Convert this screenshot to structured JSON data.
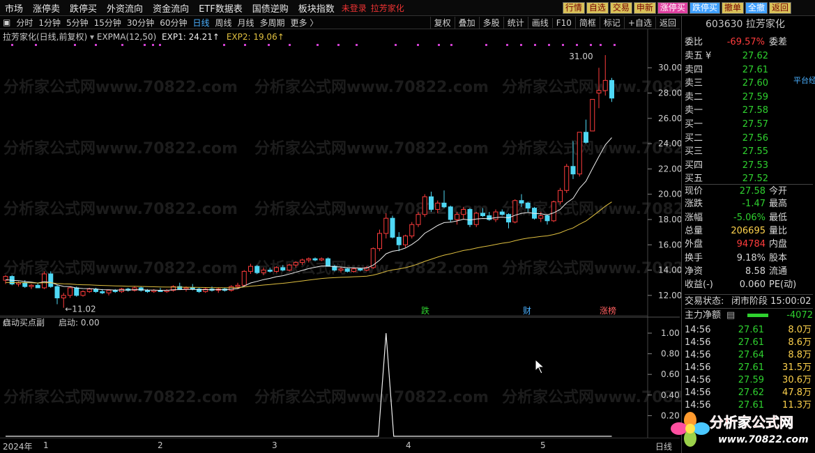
{
  "topnav": {
    "items": [
      "市场",
      "涨停卖",
      "跌停买",
      "外资流向",
      "资金流向",
      "ETF数据表",
      "国债逆购",
      "板块指数"
    ],
    "login": "未登录",
    "stock": "拉芳家化",
    "buttons": [
      "行情",
      "自选",
      "交易",
      "申新",
      "涨停买",
      "跌停买",
      "撤单",
      "全撤",
      "返回"
    ]
  },
  "subbar": {
    "periods": [
      "分时",
      "1分钟",
      "5分钟",
      "15分钟",
      "30分钟",
      "60分钟",
      "日线",
      "周线",
      "月线",
      "多周期",
      "更多 〉"
    ],
    "active": "日线",
    "tools": [
      "复权",
      "叠加",
      "多股",
      "统计",
      "画线",
      "F10",
      "简框",
      "标记",
      "+自选",
      "返回"
    ]
  },
  "chart": {
    "title": "拉芳家化(日线,前复权)",
    "indicator": "EXPMA(12,50)",
    "exp1": "EXP1: 24.21↑",
    "exp2": "EXP2: 19.06↑",
    "high_label": "31.00",
    "low_label": "←11.02",
    "yticks": [
      "30.00",
      "28.00",
      "26.00",
      "24.00",
      "22.00",
      "20.00",
      "18.00",
      "16.00",
      "14.00",
      "12.00"
    ],
    "events": [
      "跌",
      "财",
      "涨榜"
    ],
    "sub_title": "启动买点副",
    "sub_value": "启动: 0.00",
    "sub_yticks": [
      "1.00",
      "0.80",
      "0.60",
      "0.40",
      "0.20"
    ],
    "date_year": "2024年",
    "date_labels": [
      "1",
      "2",
      "3",
      "4",
      "5"
    ],
    "period_tab": "日线",
    "watermark": "分析家公式网www.70822.com"
  },
  "quote": {
    "code_name": "603630 拉芳家化",
    "weibi_label": "委比",
    "weibi": "-69.57%",
    "weicha_label": "委差",
    "asks": [
      {
        "l": "卖五",
        "p": "27.62"
      },
      {
        "l": "卖四",
        "p": "27.61"
      },
      {
        "l": "卖三",
        "p": "27.60"
      },
      {
        "l": "卖二",
        "p": "27.59"
      },
      {
        "l": "卖一",
        "p": "27.58"
      }
    ],
    "bids": [
      {
        "l": "买一",
        "p": "27.57"
      },
      {
        "l": "买二",
        "p": "27.56"
      },
      {
        "l": "买三",
        "p": "27.55"
      },
      {
        "l": "买四",
        "p": "27.53"
      },
      {
        "l": "买五",
        "p": "27.52"
      }
    ],
    "yen": "¥",
    "platform": "平台经",
    "stats": [
      {
        "l": "现价",
        "v": "27.58",
        "c": "g",
        "l2": "今开"
      },
      {
        "l": "涨跌",
        "v": "-1.47",
        "c": "g",
        "l2": "最高"
      },
      {
        "l": "涨幅",
        "v": "-5.06%",
        "c": "g",
        "l2": "最低"
      },
      {
        "l": "总量",
        "v": "206695",
        "c": "y",
        "l2": "量比"
      },
      {
        "l": "外盘",
        "v": "94784",
        "c": "r",
        "l2": "内盘"
      },
      {
        "l": "换手",
        "v": "9.18%",
        "c": "w",
        "l2": "股本"
      },
      {
        "l": "净资",
        "v": "8.58",
        "c": "w",
        "l2": "流通"
      },
      {
        "l": "收益(-)",
        "v": "0.060",
        "c": "w",
        "l2": "PE(动)"
      }
    ],
    "status_label": "交易状态:",
    "status": "闭市阶段 15:00:02",
    "flow_label": "主力净额",
    "flow": "-4072",
    "ticks": [
      [
        "14:56",
        "27.61",
        "8.0万"
      ],
      [
        "14:56",
        "27.61",
        "8.6万"
      ],
      [
        "14:56",
        "27.64",
        "8.8万"
      ],
      [
        "14:56",
        "27.61",
        "31.5万"
      ],
      [
        "14:56",
        "27.59",
        "30.6万"
      ],
      [
        "14:56",
        "27.62",
        "47.8万"
      ],
      [
        "14:56",
        "27.61",
        "11.3万"
      ]
    ]
  },
  "logo": {
    "name": "分析家公式网",
    "url": "www.70822.com"
  },
  "chart_data": {
    "type": "candlestick",
    "ylim": [
      11,
      31.5
    ],
    "candles": [
      [
        13.2,
        13.6,
        12.9,
        13.5
      ],
      [
        13.5,
        13.6,
        12.8,
        12.9
      ],
      [
        12.9,
        13.1,
        12.7,
        13.0
      ],
      [
        13.0,
        13.2,
        12.6,
        12.7
      ],
      [
        12.7,
        12.9,
        12.5,
        12.8
      ],
      [
        12.8,
        13.0,
        12.6,
        12.6
      ],
      [
        12.6,
        13.9,
        12.5,
        13.7
      ],
      [
        13.7,
        13.9,
        12.6,
        12.7
      ],
      [
        12.7,
        12.8,
        11.3,
        11.8
      ],
      [
        11.8,
        12.2,
        11.02,
        12.0
      ],
      [
        12.0,
        12.7,
        11.8,
        12.6
      ],
      [
        12.6,
        12.7,
        11.9,
        12.0
      ],
      [
        12.0,
        12.4,
        11.9,
        12.3
      ],
      [
        12.3,
        12.6,
        12.2,
        12.5
      ],
      [
        12.5,
        12.6,
        12.2,
        12.3
      ],
      [
        12.3,
        12.5,
        12.1,
        12.2
      ],
      [
        12.2,
        12.4,
        12.0,
        12.4
      ],
      [
        12.4,
        12.5,
        12.2,
        12.3
      ],
      [
        12.3,
        12.6,
        12.2,
        12.5
      ],
      [
        12.5,
        12.6,
        12.3,
        12.4
      ],
      [
        12.4,
        12.7,
        12.3,
        12.6
      ],
      [
        12.6,
        12.7,
        12.3,
        12.4
      ],
      [
        12.4,
        12.5,
        12.2,
        12.3
      ],
      [
        12.3,
        12.5,
        12.2,
        12.4
      ],
      [
        12.4,
        12.6,
        12.3,
        12.3
      ],
      [
        12.3,
        12.5,
        12.2,
        12.4
      ],
      [
        12.4,
        12.8,
        12.3,
        12.7
      ],
      [
        12.7,
        13.0,
        12.5,
        12.5
      ],
      [
        12.5,
        12.7,
        12.3,
        12.6
      ],
      [
        12.6,
        12.9,
        12.4,
        12.5
      ],
      [
        12.5,
        12.6,
        12.2,
        12.3
      ],
      [
        12.3,
        12.6,
        12.2,
        12.5
      ],
      [
        12.5,
        12.7,
        12.3,
        12.4
      ],
      [
        12.4,
        12.6,
        12.2,
        12.5
      ],
      [
        12.5,
        12.6,
        12.3,
        12.4
      ],
      [
        12.4,
        12.8,
        12.3,
        12.7
      ],
      [
        12.7,
        13.0,
        12.5,
        12.8
      ],
      [
        12.8,
        14.0,
        12.7,
        13.9
      ],
      [
        13.9,
        14.5,
        13.7,
        14.3
      ],
      [
        14.3,
        14.4,
        13.7,
        13.8
      ],
      [
        13.8,
        14.2,
        13.6,
        14.0
      ],
      [
        14.0,
        14.2,
        13.8,
        13.9
      ],
      [
        13.9,
        14.3,
        13.8,
        14.2
      ],
      [
        14.2,
        14.4,
        13.9,
        14.0
      ],
      [
        14.0,
        14.5,
        13.9,
        14.4
      ],
      [
        14.4,
        14.7,
        14.2,
        14.6
      ],
      [
        14.6,
        14.9,
        14.4,
        14.8
      ],
      [
        14.8,
        15.0,
        14.6,
        14.9
      ],
      [
        14.9,
        15.0,
        14.7,
        14.8
      ],
      [
        14.8,
        15.0,
        14.7,
        14.9
      ],
      [
        14.9,
        15.0,
        14.3,
        14.3
      ],
      [
        14.3,
        14.4,
        13.9,
        14.0
      ],
      [
        14.0,
        14.2,
        13.8,
        14.1
      ],
      [
        14.1,
        14.2,
        13.8,
        13.9
      ],
      [
        13.9,
        14.2,
        13.8,
        14.1
      ],
      [
        14.1,
        14.2,
        13.9,
        14.0
      ],
      [
        14.0,
        14.3,
        13.9,
        14.2
      ],
      [
        14.2,
        15.8,
        14.1,
        15.7
      ],
      [
        15.7,
        17.2,
        15.5,
        16.9
      ],
      [
        16.9,
        18.5,
        16.5,
        18.1
      ],
      [
        18.1,
        18.3,
        16.5,
        16.6
      ],
      [
        16.6,
        17.0,
        15.5,
        16.0
      ],
      [
        16.0,
        16.8,
        15.8,
        16.7
      ],
      [
        16.7,
        17.8,
        16.5,
        17.6
      ],
      [
        17.6,
        18.6,
        17.4,
        18.4
      ],
      [
        18.4,
        20.0,
        18.2,
        19.8
      ],
      [
        19.8,
        20.2,
        18.6,
        18.8
      ],
      [
        18.8,
        19.5,
        18.5,
        19.3
      ],
      [
        19.3,
        20.3,
        18.9,
        19.0
      ],
      [
        19.0,
        19.1,
        17.8,
        18.0
      ],
      [
        18.0,
        18.6,
        17.6,
        18.4
      ],
      [
        18.4,
        19.0,
        18.0,
        18.8
      ],
      [
        18.8,
        18.9,
        17.4,
        17.6
      ],
      [
        17.6,
        18.6,
        17.4,
        18.5
      ],
      [
        18.5,
        18.9,
        18.2,
        18.3
      ],
      [
        18.3,
        18.6,
        17.9,
        18.0
      ],
      [
        18.0,
        18.8,
        17.8,
        18.6
      ],
      [
        18.6,
        18.8,
        18.3,
        18.4
      ],
      [
        18.4,
        18.5,
        17.3,
        17.8
      ],
      [
        17.8,
        19.6,
        17.7,
        19.5
      ],
      [
        19.5,
        20.0,
        19.0,
        19.3
      ],
      [
        19.3,
        19.4,
        18.6,
        18.9
      ],
      [
        18.9,
        19.0,
        18.0,
        18.1
      ],
      [
        18.1,
        18.6,
        17.8,
        18.3
      ],
      [
        18.3,
        18.4,
        17.6,
        17.9
      ],
      [
        17.9,
        19.5,
        17.8,
        19.4
      ],
      [
        19.4,
        20.5,
        19.2,
        20.3
      ],
      [
        20.3,
        22.4,
        20.1,
        22.2
      ],
      [
        22.2,
        24.2,
        21.2,
        21.6
      ],
      [
        21.6,
        24.9,
        21.4,
        24.9
      ],
      [
        24.9,
        25.9,
        24.0,
        24.1
      ],
      [
        25.0,
        27.5,
        25.0,
        27.5
      ],
      [
        28.0,
        30.0,
        26.8,
        28.2
      ],
      [
        28.2,
        31.0,
        27.8,
        29.0
      ],
      [
        29.0,
        29.2,
        27.3,
        27.6
      ]
    ],
    "exp1": [
      13.2,
      12.5,
      12.7,
      13.5,
      14.4,
      16.0,
      18.3,
      24.2
    ],
    "exp2": [
      13.0,
      12.7,
      12.6,
      13.4,
      14.8,
      16.8,
      18.5,
      19.06
    ],
    "signal_peak": 1.0,
    "signal_peak_index": 59
  }
}
